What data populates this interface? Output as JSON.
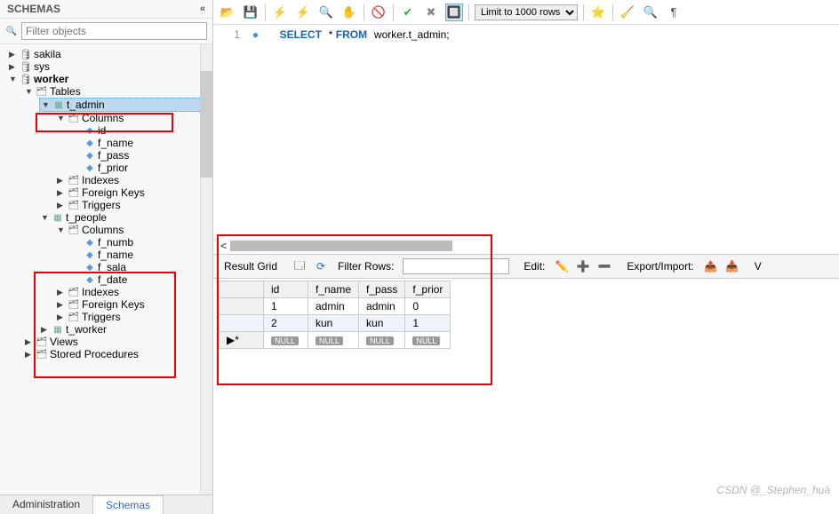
{
  "sidebar": {
    "title": "SCHEMAS",
    "filter_placeholder": "Filter objects",
    "schemas": [
      {
        "name": "sakila",
        "expanded": false
      },
      {
        "name": "sys",
        "expanded": false
      },
      {
        "name": "worker",
        "expanded": true,
        "tables_label": "Tables",
        "tables": [
          {
            "name": "t_admin",
            "selected": true,
            "columns_label": "Columns",
            "columns": [
              "id",
              "f_name",
              "f_pass",
              "f_prior"
            ],
            "indexes_label": "Indexes",
            "fk_label": "Foreign Keys",
            "triggers_label": "Triggers"
          },
          {
            "name": "t_people",
            "columns_label": "Columns",
            "columns": [
              "f_numb",
              "f_name",
              "f_sala",
              "f_date"
            ],
            "indexes_label": "Indexes",
            "fk_label": "Foreign Keys",
            "triggers_label": "Triggers"
          },
          {
            "name": "t_worker"
          }
        ],
        "views_label": "Views",
        "sp_label": "Stored Procedures"
      }
    ],
    "tabs": {
      "admin": "Administration",
      "schemas": "Schemas"
    }
  },
  "toolbar": {
    "limit_label": "Limit to 1000 rows"
  },
  "sql": {
    "line_no": "1",
    "select": "SELECT",
    "star": "*",
    "from": "FROM",
    "target": "worker.t_admin;"
  },
  "result": {
    "grid_label": "Result Grid",
    "filter_label": "Filter Rows:",
    "edit_label": "Edit:",
    "export_label": "Export/Import:",
    "headers": [
      "id",
      "f_name",
      "f_pass",
      "f_prior"
    ],
    "rows": [
      {
        "id": "1",
        "f_name": "admin",
        "f_pass": "admin",
        "f_prior": "0"
      },
      {
        "id": "2",
        "f_name": "kun",
        "f_pass": "kun",
        "f_prior": "1"
      }
    ],
    "null_label": "NULL"
  },
  "watermark": "CSDN @_Stephen_huà"
}
